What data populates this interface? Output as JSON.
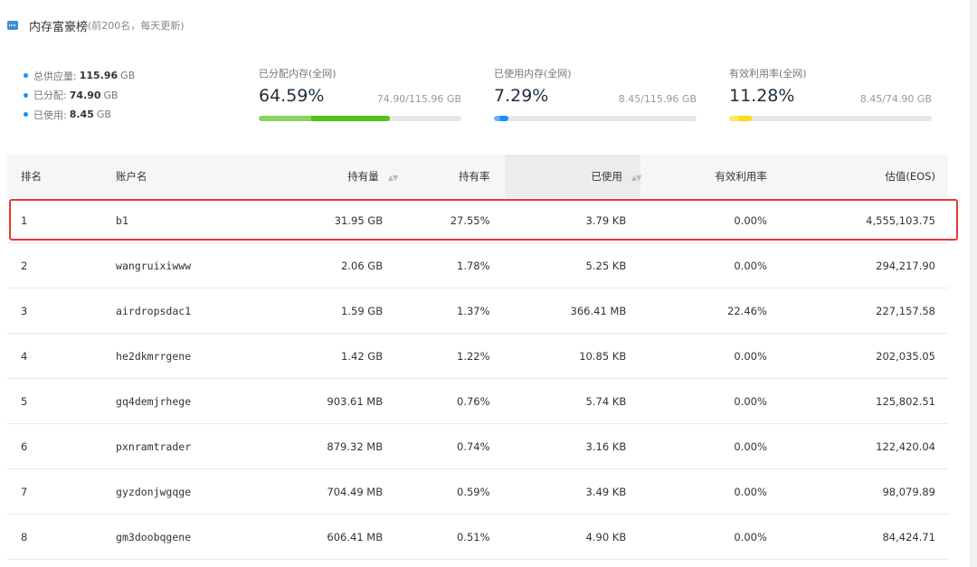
{
  "header": {
    "title": "内存富豪榜",
    "subtitle": "(前200名，每天更新)",
    "icon": "ram-icon"
  },
  "summary": {
    "items": [
      {
        "label": "总供应量:",
        "value": "115.96",
        "unit": "GB"
      },
      {
        "label": "已分配:",
        "value": "74.90",
        "unit": "GB"
      },
      {
        "label": "已使用:",
        "value": "8.45",
        "unit": "GB"
      }
    ]
  },
  "metrics": [
    {
      "label": "已分配内存(全网)",
      "percent": "64.59%",
      "ratio": "74.90/115.96 GB",
      "fill_fraction": 0.6459,
      "fill_color": "#52c41a",
      "fill_color_light": "#8bd45e"
    },
    {
      "label": "已使用内存(全网)",
      "percent": "7.29%",
      "ratio": "8.45/115.96 GB",
      "fill_fraction": 0.0729,
      "fill_color": "#1890ff",
      "fill_color_light": "#69b4ff"
    },
    {
      "label": "有效利用率(全网)",
      "percent": "11.28%",
      "ratio": "8.45/74.90 GB",
      "fill_fraction": 0.1128,
      "fill_color": "#fadb14",
      "fill_color_light": "#fde868"
    }
  ],
  "table": {
    "headers": {
      "rank": "排名",
      "account": "账户名",
      "holding": "持有量",
      "rate": "持有率",
      "used": "已使用",
      "efficiency": "有效利用率",
      "value": "估值(EOS)"
    },
    "highlighted_row": 0,
    "rows": [
      {
        "rank": "1",
        "account": "b1",
        "holding": "31.95 GB",
        "rate": "27.55%",
        "used": "3.79 KB",
        "efficiency": "0.00%",
        "value": "4,555,103.75"
      },
      {
        "rank": "2",
        "account": "wangruixiwww",
        "holding": "2.06 GB",
        "rate": "1.78%",
        "used": "5.25 KB",
        "efficiency": "0.00%",
        "value": "294,217.90"
      },
      {
        "rank": "3",
        "account": "airdropsdac1",
        "holding": "1.59 GB",
        "rate": "1.37%",
        "used": "366.41 MB",
        "efficiency": "22.46%",
        "value": "227,157.58"
      },
      {
        "rank": "4",
        "account": "he2dkmrrgene",
        "holding": "1.42 GB",
        "rate": "1.22%",
        "used": "10.85 KB",
        "efficiency": "0.00%",
        "value": "202,035.05"
      },
      {
        "rank": "5",
        "account": "gq4demjrhege",
        "holding": "903.61 MB",
        "rate": "0.76%",
        "used": "5.74 KB",
        "efficiency": "0.00%",
        "value": "125,802.51"
      },
      {
        "rank": "6",
        "account": "pxnramtrader",
        "holding": "879.32 MB",
        "rate": "0.74%",
        "used": "3.16 KB",
        "efficiency": "0.00%",
        "value": "122,420.04"
      },
      {
        "rank": "7",
        "account": "gyzdonjwgqge",
        "holding": "704.49 MB",
        "rate": "0.59%",
        "used": "3.49 KB",
        "efficiency": "0.00%",
        "value": "98,079.89"
      },
      {
        "rank": "8",
        "account": "gm3doobqgene",
        "holding": "606.41 MB",
        "rate": "0.51%",
        "used": "4.90 KB",
        "efficiency": "0.00%",
        "value": "84,424.71"
      }
    ]
  }
}
